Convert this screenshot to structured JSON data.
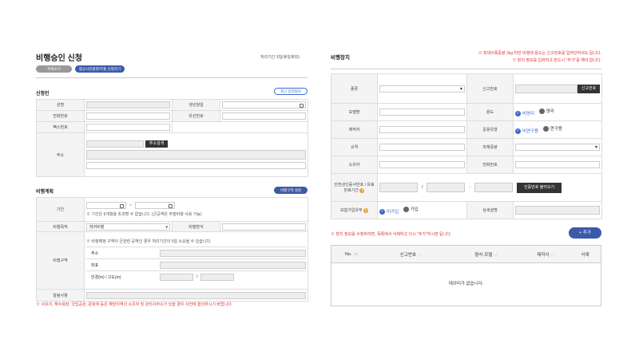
{
  "left": {
    "title": "비행승인 신청",
    "processing_note": "처리기간 3일(휴일제외)",
    "btn_list": "목록보기",
    "btn_apply": "항공사진촬영/부품 신청하기",
    "applicant": {
      "heading": "신청인",
      "recent_btn": "최근 입력정보",
      "labels": [
        "성명",
        "생년월일",
        "전화번호",
        "유선번호",
        "팩스번호",
        "주소"
      ],
      "addr_search": "주소검색"
    },
    "plan": {
      "heading": "비행계획",
      "zone_btn": "비행구역 설정",
      "period_label": "기간",
      "period_sep": "~",
      "period_note": "※ 기간은 6개월을 초과할 수 없습니다. (군공역은 주말비행 사용 가능)",
      "purpose_label": "비행목적",
      "purpose_value": "레저비행",
      "method_label": "비행방식",
      "zone_label": "비행구역",
      "zone_note": "※ 비행예정 구역이 군관련 공역인 경우 처리기간이 5일 소요될 수 있습니다.",
      "zone_addr": "주소",
      "zone_coord": "좌표",
      "zone_radius": "반경(m) / 고도(m)",
      "zone_slash": "/",
      "memo_label": "알림사항",
      "footnote": "※ 사유지, 해수욕장, 국립공원, 문화재 등은 해당지역의 소유자 및 관리사무소가 있을 경우 사전에 협의하시기 바랍니다."
    }
  },
  "right": {
    "title": "비행장치",
    "notice1": "※ 최대이륙중량 2kg 미만 비행레 용도는 신고번호를 입력안하셔도 됩니다.",
    "notice2": "※ 장치 정보를 입력하고 반드시 \"추가\"를 해야 합니다.",
    "labels": {
      "type": "종류",
      "reg_no": "신고번호",
      "model": "모델명",
      "usage": "용도",
      "maker": "제작자",
      "op_type": "운용유형",
      "spec": "규격",
      "weight": "자체중량",
      "owner": "소유자",
      "phone": "전화번호",
      "cert": "안전성인증서번호 / 유효만료기간",
      "insurance": "보험가입유무",
      "detail": "상세설명"
    },
    "reg_btn": "신고번호",
    "cert_btn": "인증번호 불러오기",
    "dash": "-",
    "slash": "/",
    "usage_opts": [
      "비영리",
      "영리"
    ],
    "op_opts": [
      "비연구용",
      "연구용"
    ],
    "ins_opts": [
      "미가입",
      "가입"
    ],
    "edit_note": "※ 장치 정보를 수정하려면, 목록에서 삭제하고 다시 \"추가\"하시면 됩니다.",
    "add_btn": "+ 추가",
    "columns": [
      "No.",
      "신고번호",
      "형식·모델",
      "제작사",
      "삭제"
    ],
    "empty": "데이터가 없습니다."
  },
  "colors": {
    "accent": "#3d6ad0",
    "dark": "#333333",
    "warning": "#d33333"
  }
}
